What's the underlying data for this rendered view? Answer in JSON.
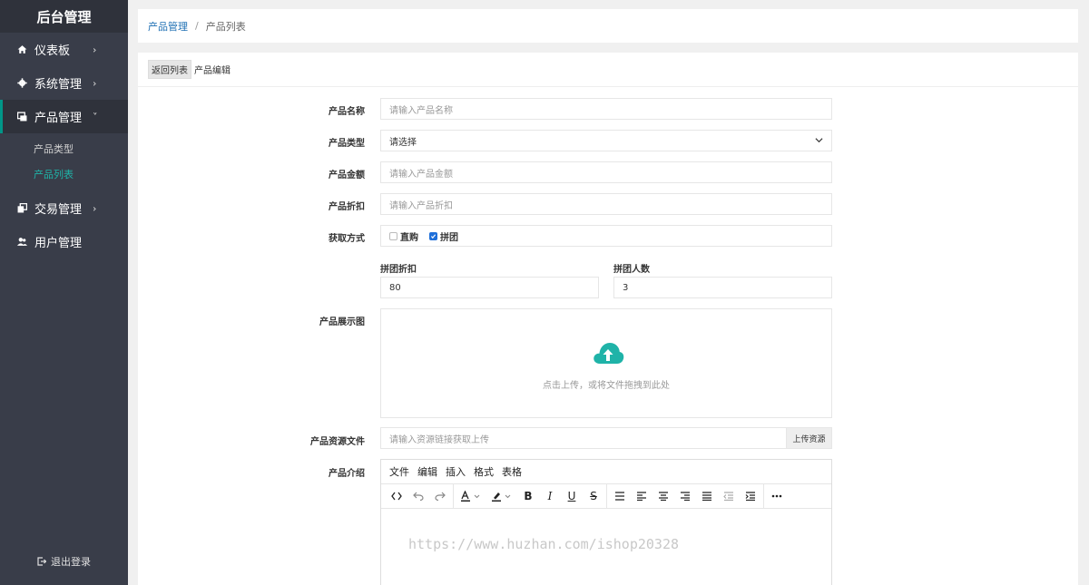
{
  "sidebar": {
    "logo": "后台管理",
    "items": [
      {
        "label": "仪表板",
        "chevron": "›"
      },
      {
        "label": "系统管理",
        "chevron": "›"
      },
      {
        "label": "产品管理",
        "chevron": "˅"
      },
      {
        "label": "交易管理",
        "chevron": "›"
      },
      {
        "label": "用户管理"
      }
    ],
    "sub_items": [
      {
        "label": "产品类型"
      },
      {
        "label": "产品列表"
      }
    ],
    "logout_label": "退出登录"
  },
  "breadcrumb": {
    "parent": "产品管理",
    "separator": "/",
    "current": "产品列表"
  },
  "card": {
    "back_label": "返回列表",
    "title": "产品编辑"
  },
  "form": {
    "name": {
      "label": "产品名称",
      "placeholder": "请输入产品名称"
    },
    "type": {
      "label": "产品类型",
      "value": "请选择"
    },
    "amount": {
      "label": "产品金额",
      "placeholder": "请输入产品金额"
    },
    "discount": {
      "label": "产品折扣",
      "placeholder": "请输入产品折扣"
    },
    "method": {
      "label": "获取方式",
      "options": [
        {
          "label": "直购",
          "checked": false
        },
        {
          "label": "拼团",
          "checked": true
        }
      ]
    },
    "group_discount": {
      "label": "拼团折扣",
      "value": "80"
    },
    "group_size": {
      "label": "拼团人数",
      "value": "3"
    },
    "images": {
      "label": "产品展示图",
      "hint": "点击上传，或将文件拖拽到此处"
    },
    "resource": {
      "label": "产品资源文件",
      "placeholder": "请输入资源链接获取上传",
      "button": "上传资源"
    },
    "intro": {
      "label": "产品介绍",
      "menus": [
        "文件",
        "编辑",
        "插入",
        "格式",
        "表格"
      ]
    }
  },
  "watermark": "https://www.huzhan.com/ishop20328",
  "colors": {
    "sidebar_bg": "#393d49",
    "accent": "#009688",
    "link": "#1e6fb3",
    "checkbox": "#1e6fd9",
    "upload_icon": "#1fb3a8"
  }
}
